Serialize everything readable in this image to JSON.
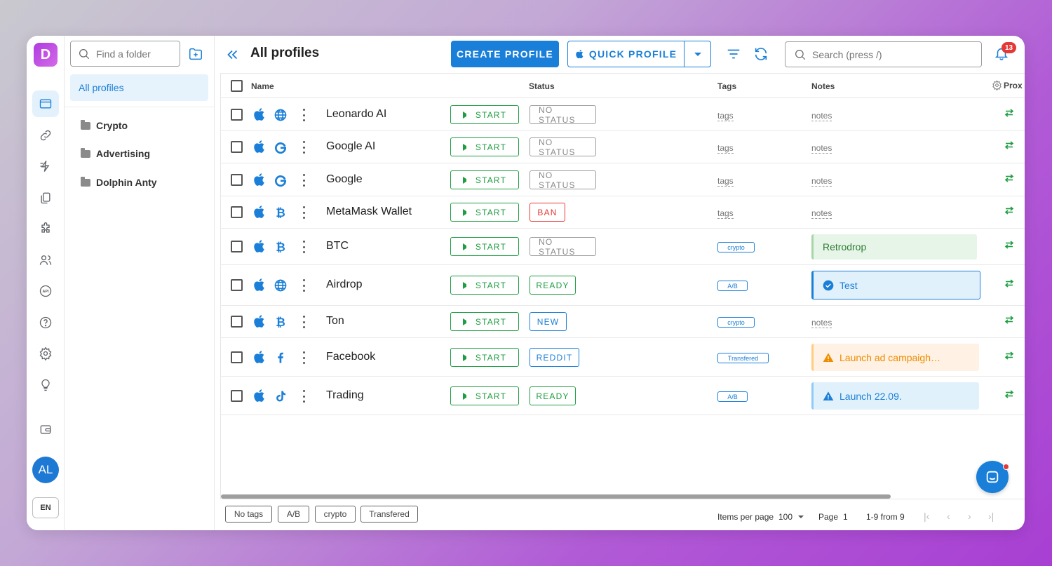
{
  "app": {
    "logo_letter": "D",
    "accent": "#1a7fd8",
    "success": "#1e9e42",
    "danger": "#e53935"
  },
  "rail": {
    "items": [
      {
        "name": "profiles-icon",
        "active": true
      },
      {
        "name": "link-icon"
      },
      {
        "name": "automation-icon"
      },
      {
        "name": "copy-icon"
      },
      {
        "name": "extensions-icon"
      },
      {
        "name": "users-icon"
      },
      {
        "name": "api-icon"
      },
      {
        "name": "help-icon"
      },
      {
        "name": "settings-icon"
      },
      {
        "name": "lightbulb-icon"
      },
      {
        "name": "wallet-icon"
      }
    ],
    "avatar": "AL",
    "language": "EN"
  },
  "folders": {
    "search_placeholder": "Find a folder",
    "all_profiles": "All profiles",
    "items": [
      "Crypto",
      "Advertising",
      "Dolphin Anty"
    ]
  },
  "header": {
    "title": "All profiles",
    "create_button": "CREATE PROFILE",
    "quick_button": "QUICK PROFILE",
    "search_placeholder": "Search (press /)",
    "notifications": "13"
  },
  "table": {
    "columns": {
      "name": "Name",
      "status": "Status",
      "tags": "Tags",
      "notes": "Notes",
      "proxy": "Prox"
    },
    "start_label": "START",
    "rows": [
      {
        "os": "apple",
        "ua": "globe",
        "name": "Leonardo AI",
        "status": "NO STATUS",
        "status_kind": "none",
        "tags": "tags",
        "tag_kind": "plain",
        "notes": "notes",
        "note_kind": "plain"
      },
      {
        "os": "apple",
        "ua": "google",
        "name": "Google AI",
        "status": "NO STATUS",
        "status_kind": "none",
        "tags": "tags",
        "tag_kind": "plain",
        "notes": "notes",
        "note_kind": "plain"
      },
      {
        "os": "apple",
        "ua": "google",
        "name": "Google",
        "status": "NO STATUS",
        "status_kind": "none",
        "tags": "tags",
        "tag_kind": "plain",
        "notes": "notes",
        "note_kind": "plain"
      },
      {
        "os": "apple",
        "ua": "bitcoin",
        "name": "MetaMask Wallet",
        "status": "BAN",
        "status_kind": "ban",
        "tags": "tags",
        "tag_kind": "plain",
        "notes": "notes",
        "note_kind": "plain"
      },
      {
        "os": "apple",
        "ua": "bitcoin",
        "name": "BTC",
        "status": "NO STATUS",
        "status_kind": "none",
        "tags": "crypto",
        "tag_kind": "chip",
        "notes": "Retrodrop",
        "note_kind": "green"
      },
      {
        "os": "apple",
        "ua": "globe",
        "name": "Airdrop",
        "status": "READY",
        "status_kind": "ready",
        "tags": "A/B",
        "tag_kind": "chip",
        "notes": "Test",
        "note_kind": "blue-outline"
      },
      {
        "os": "apple",
        "ua": "bitcoin",
        "name": "Ton",
        "status": "NEW",
        "status_kind": "new",
        "tags": "crypto",
        "tag_kind": "chip",
        "notes": "notes",
        "note_kind": "plain"
      },
      {
        "os": "apple",
        "ua": "facebook",
        "name": "Facebook",
        "status": "REDDIT",
        "status_kind": "reddit",
        "tags": "Transfered",
        "tag_kind": "chip",
        "notes": "Launch ad campaigh…",
        "note_kind": "orange"
      },
      {
        "os": "apple",
        "ua": "tiktok",
        "name": "Trading",
        "status": "READY",
        "status_kind": "ready",
        "tags": "A/B",
        "tag_kind": "chip",
        "notes": "Launch 22.09.",
        "note_kind": "blue"
      }
    ]
  },
  "footer": {
    "tag_filters": [
      "No tags",
      "A/B",
      "crypto",
      "Transfered"
    ],
    "items_per_page_label": "Items per page",
    "items_per_page": "100",
    "page_label": "Page",
    "page": "1",
    "range": "1-9 from 9"
  }
}
